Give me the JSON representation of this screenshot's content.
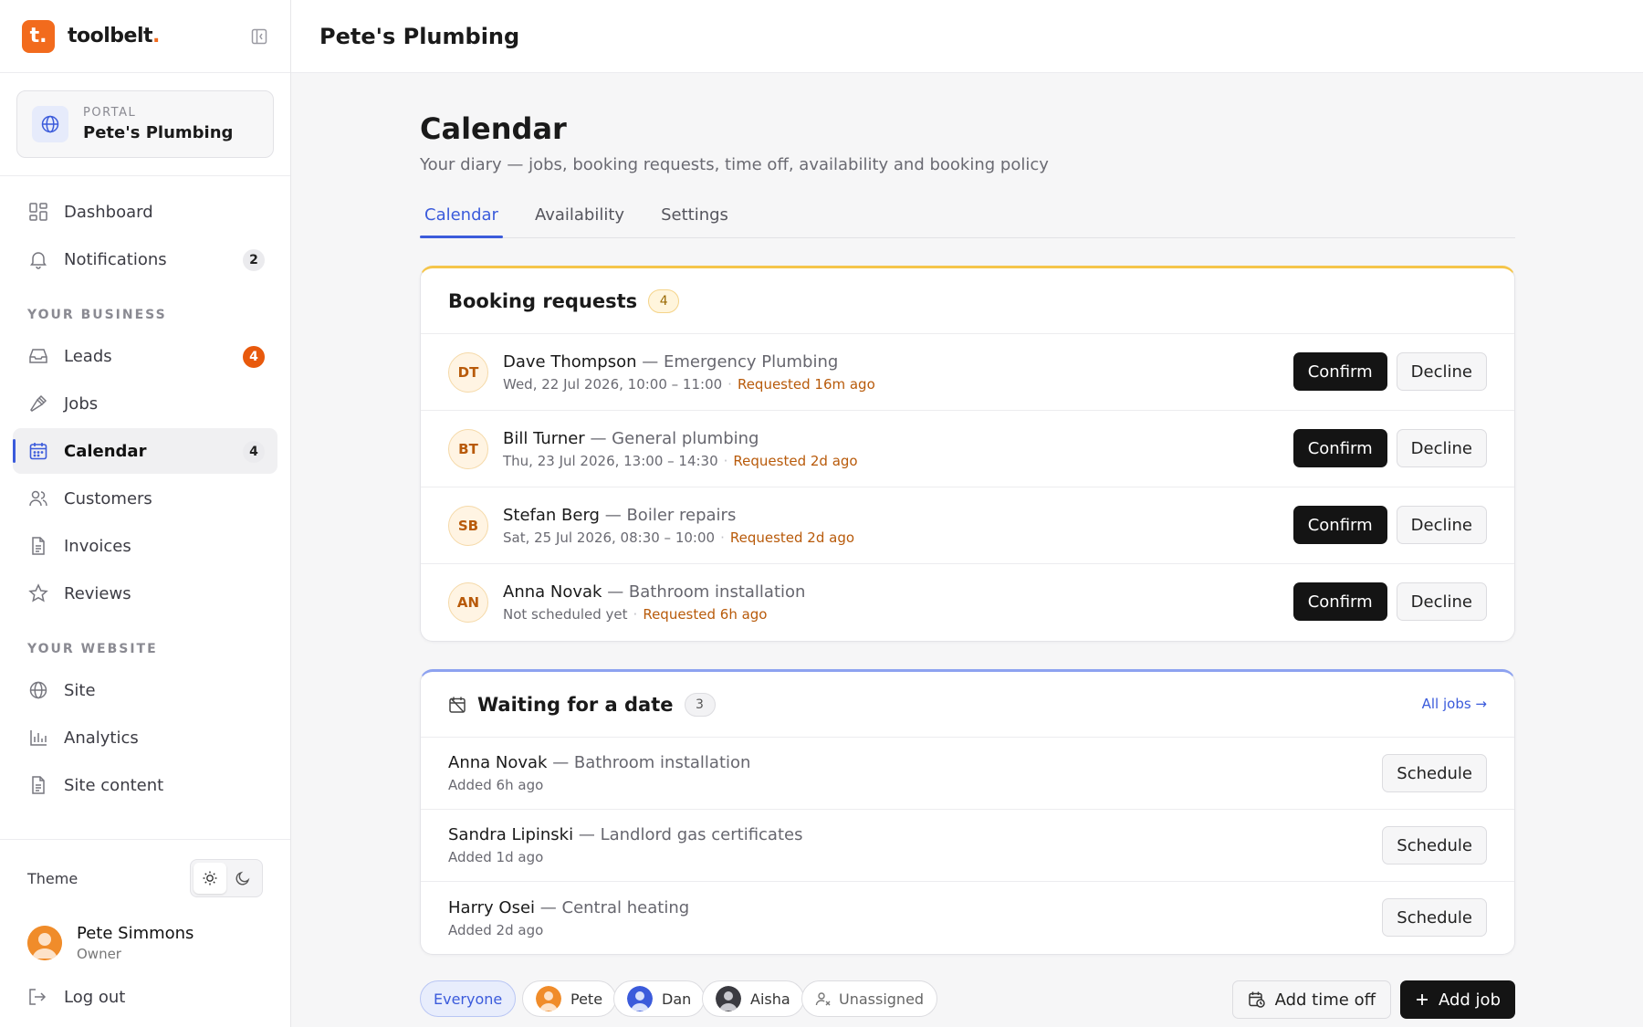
{
  "brand": {
    "logo_letter": "t.",
    "name": "toolbelt",
    "dot": "."
  },
  "portal": {
    "label": "PORTAL",
    "name": "Pete's Plumbing"
  },
  "nav": {
    "top": [
      {
        "label": "Dashboard",
        "icon": "dashboard-icon"
      },
      {
        "label": "Notifications",
        "icon": "bell-icon",
        "badge": "2"
      }
    ],
    "business_heading": "YOUR BUSINESS",
    "business": [
      {
        "label": "Leads",
        "icon": "inbox-icon",
        "badge": "4"
      },
      {
        "label": "Jobs",
        "icon": "hammer-icon"
      },
      {
        "label": "Calendar",
        "icon": "calendar-icon",
        "badge": "4"
      },
      {
        "label": "Customers",
        "icon": "users-icon"
      },
      {
        "label": "Invoices",
        "icon": "file-icon"
      },
      {
        "label": "Reviews",
        "icon": "star-icon"
      }
    ],
    "website_heading": "YOUR WEBSITE",
    "website": [
      {
        "label": "Site",
        "icon": "globe-icon"
      },
      {
        "label": "Analytics",
        "icon": "bar-chart-icon"
      },
      {
        "label": "Site content",
        "icon": "file-icon"
      }
    ]
  },
  "theme": {
    "label": "Theme",
    "selected": "light"
  },
  "user": {
    "name": "Pete Simmons",
    "role": "Owner"
  },
  "logout": "Log out",
  "header": {
    "title": "Pete's Plumbing"
  },
  "page": {
    "title": "Calendar",
    "subtitle": "Your diary — jobs, booking requests, time off, availability and booking policy",
    "tabs": [
      "Calendar",
      "Availability",
      "Settings"
    ],
    "active_tab": "Calendar"
  },
  "booking_requests": {
    "title": "Booking requests",
    "count": "4",
    "confirm_label": "Confirm",
    "decline_label": "Decline",
    "items": [
      {
        "initials": "DT",
        "name": "Dave Thompson",
        "service": "— Emergency Plumbing",
        "when": "Wed, 22 Jul 2026, 10:00 – 11:00",
        "ago": "Requested 16m ago"
      },
      {
        "initials": "BT",
        "name": "Bill Turner",
        "service": "— General plumbing",
        "when": "Thu, 23 Jul 2026, 13:00 – 14:30",
        "ago": "Requested 2d ago"
      },
      {
        "initials": "SB",
        "name": "Stefan Berg",
        "service": "— Boiler repairs",
        "when": "Sat, 25 Jul 2026, 08:30 – 10:00",
        "ago": "Requested 2d ago"
      },
      {
        "initials": "AN",
        "name": "Anna Novak",
        "service": "— Bathroom installation",
        "when": "Not scheduled yet",
        "ago": "Requested 6h ago"
      }
    ]
  },
  "waiting": {
    "title": "Waiting for a date",
    "count": "3",
    "link": "All jobs →",
    "schedule_label": "Schedule",
    "items": [
      {
        "name": "Anna Novak",
        "service": "— Bathroom installation",
        "added": "Added 6h ago"
      },
      {
        "name": "Sandra Lipinski",
        "service": "— Landlord gas certificates",
        "added": "Added 1d ago"
      },
      {
        "name": "Harry Osei",
        "service": "— Central heating",
        "added": "Added 2d ago"
      }
    ]
  },
  "filters": {
    "everyone": "Everyone",
    "people": [
      {
        "name": "Pete",
        "color": "#f08c2a"
      },
      {
        "name": "Dan",
        "color": "#3b5bdb"
      },
      {
        "name": "Aisha",
        "color": "#3a3a40"
      }
    ],
    "unassigned": "Unassigned"
  },
  "actions": {
    "add_time_off": "Add time off",
    "add_job": "Add job"
  },
  "colors": {
    "accent": "#3b5bdb",
    "brand": "#f26b1d",
    "amber": "#f5c54a"
  }
}
